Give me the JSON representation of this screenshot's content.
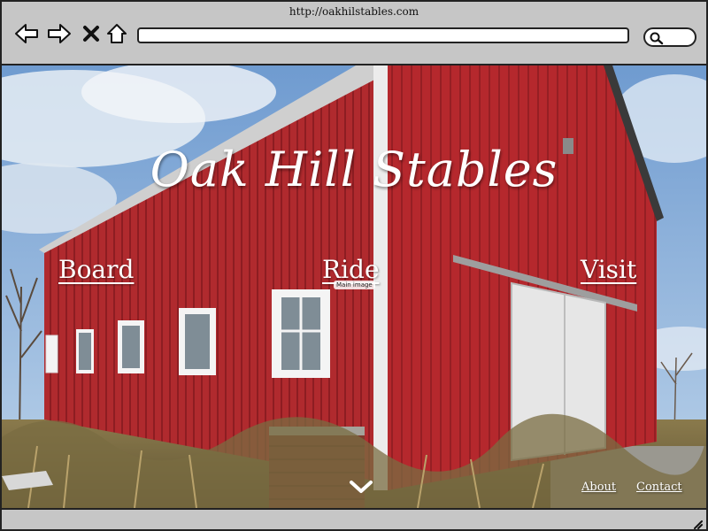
{
  "browser": {
    "url": "http://oakhilstables.com",
    "address_value": "",
    "icons": {
      "back": "back-arrow-icon",
      "forward": "forward-arrow-icon",
      "close": "close-icon",
      "home": "home-icon",
      "search": "search-icon"
    }
  },
  "hero": {
    "title": "Oak Hill Stables",
    "image_label": "Main image",
    "nav": {
      "board": "Board",
      "ride": "Ride",
      "visit": "Visit"
    },
    "scroll_icon": "chevron-down-icon"
  },
  "footer": {
    "about": "About",
    "contact": "Contact"
  },
  "colors": {
    "chrome": "#c6c6c6",
    "barn_red": "#b3272d",
    "sky": "#7fa8d6"
  }
}
